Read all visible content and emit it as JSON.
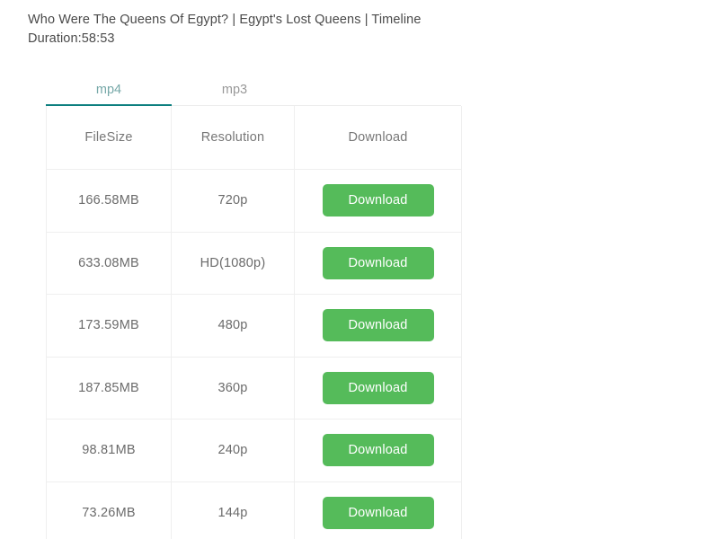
{
  "video": {
    "title": "Who Were The Queens Of Egypt? | Egypt's Lost Queens | Timeline",
    "duration_label": "Duration:58:53"
  },
  "theme": {
    "active_tab_underline": "#0c7f7f",
    "active_tab_text": "#76a8a8",
    "download_button_bg": "#55bb5a",
    "table_border": "#efefef"
  },
  "tabs": [
    {
      "id": "mp4",
      "label": "mp4",
      "active": true
    },
    {
      "id": "mp3",
      "label": "mp3",
      "active": false
    }
  ],
  "table": {
    "headers": {
      "filesize": "FileSize",
      "resolution": "Resolution",
      "download": "Download"
    },
    "rows": [
      {
        "filesize": "166.58MB",
        "resolution": "720p",
        "action": "Download"
      },
      {
        "filesize": "633.08MB",
        "resolution": "HD(1080p)",
        "action": "Download"
      },
      {
        "filesize": "173.59MB",
        "resolution": "480p",
        "action": "Download"
      },
      {
        "filesize": "187.85MB",
        "resolution": "360p",
        "action": "Download"
      },
      {
        "filesize": "98.81MB",
        "resolution": "240p",
        "action": "Download"
      },
      {
        "filesize": "73.26MB",
        "resolution": "144p",
        "action": "Download"
      }
    ]
  }
}
